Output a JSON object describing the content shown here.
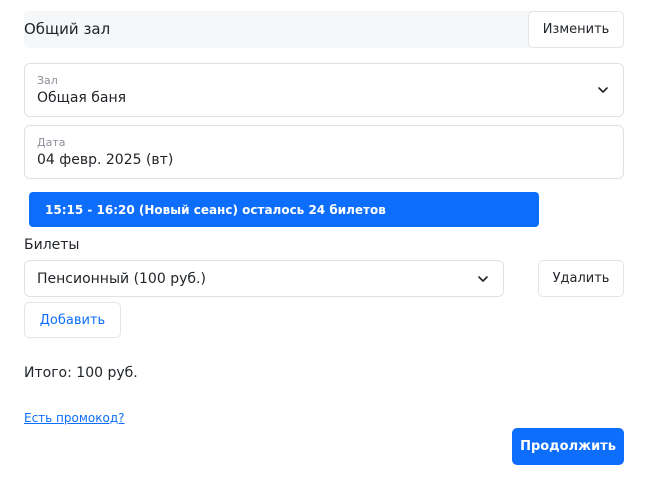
{
  "hall_header": {
    "name": "Общий зал",
    "change_label": "Изменить"
  },
  "hall_select": {
    "label": "Зал",
    "value": "Общая баня"
  },
  "date_field": {
    "label": "Дата",
    "value": "04 февр. 2025 (вт)"
  },
  "session": {
    "text": "15:15 - 16:20 (Новый сеанс) осталось 24 билетов"
  },
  "tickets": {
    "label": "Билеты",
    "selected": "Пенсионный (100 руб.)",
    "delete_label": "Удалить",
    "add_label": "Добавить"
  },
  "summary": {
    "total": "Итого: 100 руб."
  },
  "promo": {
    "link": "Есть промокод?"
  },
  "actions": {
    "continue_label": "Продолжить"
  },
  "colors": {
    "accent": "#0d6efd",
    "header_bg": "#f6f7f9"
  }
}
